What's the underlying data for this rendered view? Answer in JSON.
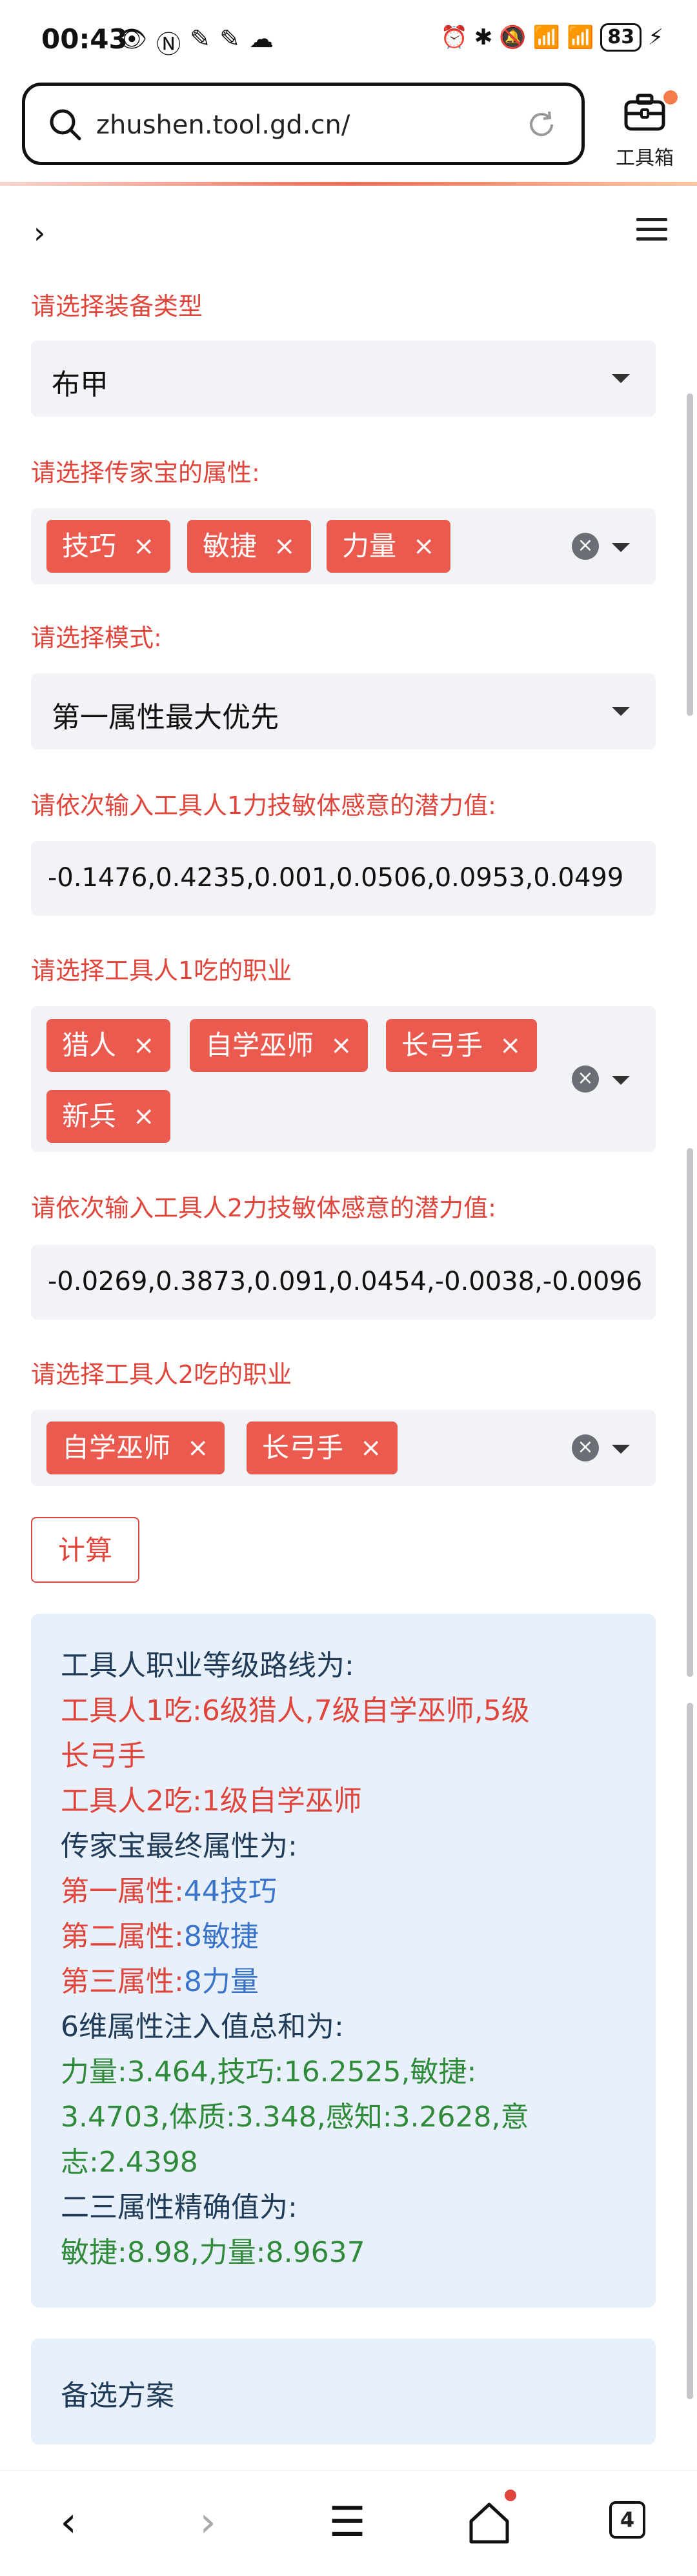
{
  "status_bar": {
    "time": "00:43",
    "battery": "83"
  },
  "browser": {
    "url": "zhushen.tool.gd.cn/",
    "toolbox_label": "工具箱",
    "tabs_count": "4"
  },
  "form": {
    "equip_type_label": "请选择装备类型",
    "equip_type_value": "布甲",
    "attr_label": "请选择传家宝的属性:",
    "attr_tags": [
      "技巧",
      "敏捷",
      "力量"
    ],
    "mode_label": "请选择模式:",
    "mode_value": "第一属性最大优先",
    "worker1_potential_label": "请依次输入工具人1力技敏体感意的潜力值:",
    "worker1_potential_value": "-0.1476,0.4235,0.001,0.0506,0.0953,0.0499",
    "worker1_jobs_label": "请选择工具人1吃的职业",
    "worker1_jobs": [
      "猎人",
      "自学巫师",
      "长弓手",
      "新兵"
    ],
    "worker2_potential_label": "请依次输入工具人2力技敏体感意的潜力值:",
    "worker2_potential_value": "-0.0269,0.3873,0.091,0.0454,-0.0038,-0.0096",
    "worker2_jobs_label": "请选择工具人2吃的职业",
    "worker2_jobs": [
      "自学巫师",
      "长弓手"
    ],
    "calc_button": "计算"
  },
  "result": {
    "route_title": "工具人职业等级路线为:",
    "worker1_route_a": "工具人1吃:6级猎人,7级自学巫师,5级",
    "worker1_route_b": "长弓手",
    "worker2_route": "工具人2吃:1级自学巫师",
    "final_title": "传家宝最终属性为:",
    "attr1_label": "第一属性:",
    "attr1_value": "44技巧",
    "attr2_label": "第二属性:",
    "attr2_value": "8敏捷",
    "attr3_label": "第三属性:",
    "attr3_value": "8力量",
    "sum_title": "6维属性注入值总和为:",
    "sum_line1": "力量:3.464,技巧:16.2525,敏捷:",
    "sum_line2": "3.4703,体质:3.348,感知:3.2628,意",
    "sum_line3": "志:2.4398",
    "precise_title": "二三属性精确值为:",
    "precise_values": "敏捷:8.98,力量:8.9637"
  },
  "alternatives": {
    "title": "备选方案"
  },
  "colors": {
    "accent_red": "#e0453b",
    "tag_red": "#ea5a4f",
    "navy": "#1f3b57",
    "blue": "#3a74c9",
    "green": "#2f8a3a",
    "result_bg": "#e8f1fb"
  }
}
